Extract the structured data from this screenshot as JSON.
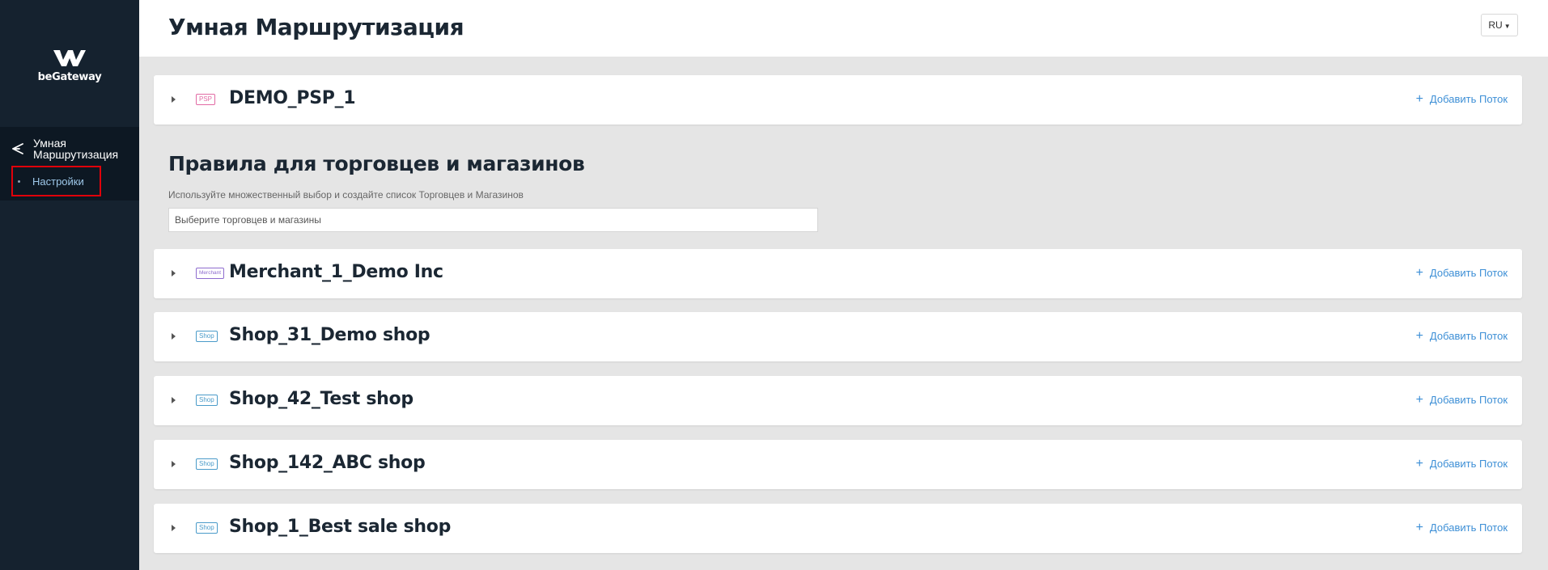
{
  "sidebar": {
    "logo_text": "beGateway",
    "nav": {
      "main_label": "Умная Маршрутизация",
      "sub_label": "Настройки"
    }
  },
  "header": {
    "title": "Умная Маршрутизация",
    "language": "RU"
  },
  "psp_card": {
    "tag": "PSP",
    "name": "DEMO_PSP_1",
    "add_label": "Добавить Поток"
  },
  "rules": {
    "title": "Правила для торговцев и магазинов",
    "description": "Используйте множественный выбор и создайте список Торговцев и Магазинов",
    "input_placeholder": "Выберите торговцев и магазины"
  },
  "items": [
    {
      "tag": "Merchant",
      "name": "Merchant_1_Demo Inc",
      "add_label": "Добавить Поток"
    },
    {
      "tag": "Shop",
      "name": "Shop_31_Demo shop",
      "add_label": "Добавить Поток"
    },
    {
      "tag": "Shop",
      "name": "Shop_42_Test shop",
      "add_label": "Добавить Поток"
    },
    {
      "tag": "Shop",
      "name": "Shop_142_ABC shop",
      "add_label": "Добавить Поток"
    },
    {
      "tag": "Shop",
      "name": "Shop_1_Best sale shop",
      "add_label": "Добавить Поток"
    }
  ],
  "colors": {
    "sidebar_bg": "#15222f",
    "accent_link": "#3d8fd6",
    "highlight_border": "#e0000a"
  }
}
